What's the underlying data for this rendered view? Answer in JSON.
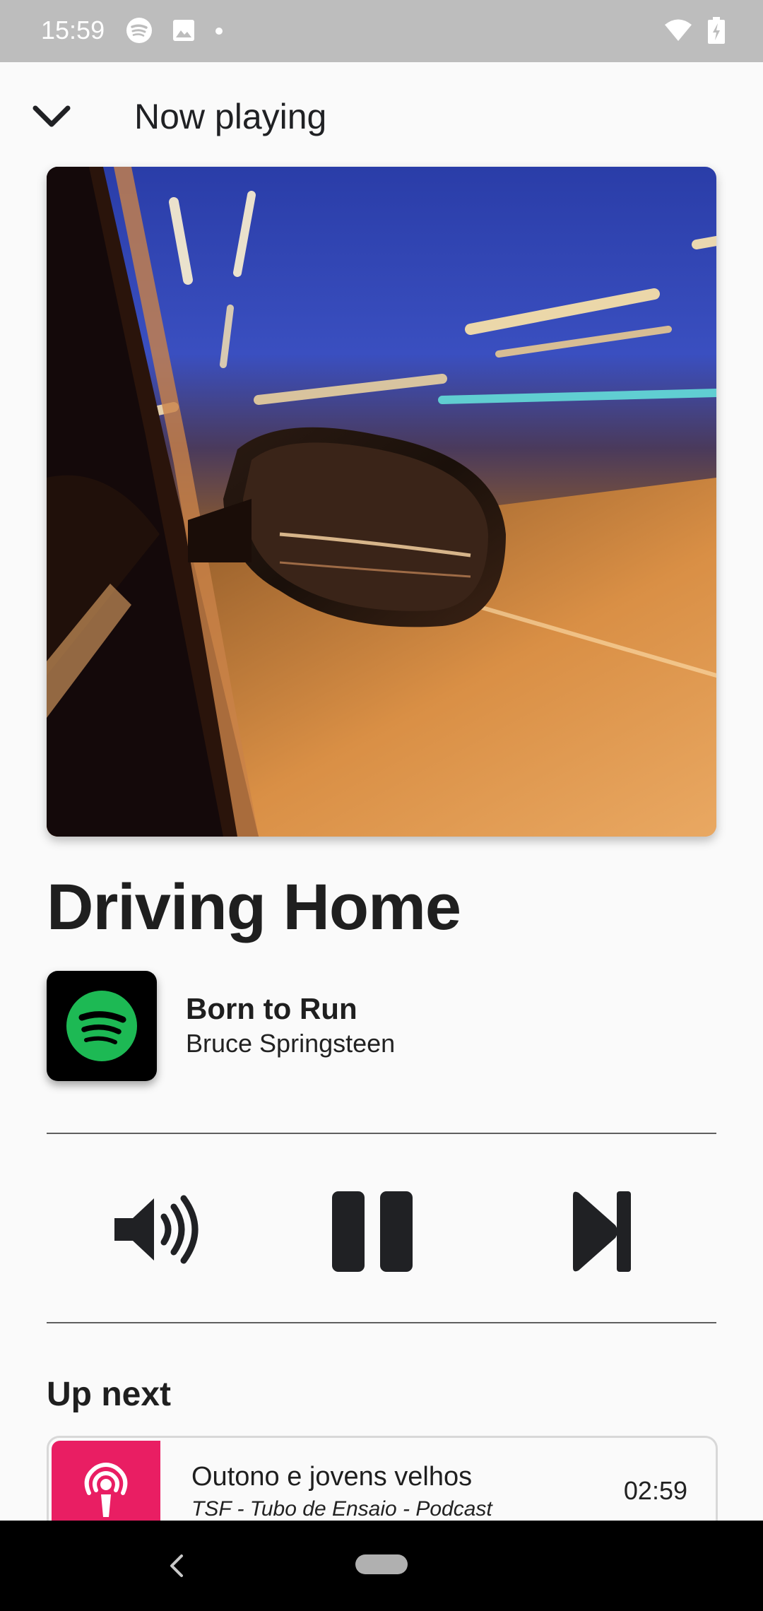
{
  "status_bar": {
    "time": "15:59",
    "icons": [
      "spotify-icon",
      "image-icon",
      "dot-icon",
      "wifi-icon",
      "battery-charging-icon"
    ]
  },
  "header": {
    "title": "Now playing",
    "collapse_icon": "chevron-down-icon"
  },
  "now_playing": {
    "title": "Driving Home",
    "album": "Born to Run",
    "artist": "Bruce Springsteen",
    "source_app_icon": "spotify-icon",
    "source_color": "#1db954"
  },
  "controls": {
    "volume_icon": "volume-icon",
    "play_pause_icon": "pause-icon",
    "next_icon": "skip-next-icon"
  },
  "up_next": {
    "heading": "Up next",
    "items": [
      {
        "title": "Outono e jovens velhos",
        "subtitle": "TSF - Tubo de Ensaio - Podcast",
        "duration": "02:59",
        "icon": "podcast-icon",
        "color": "#e91e63"
      }
    ]
  },
  "nav_bar": {
    "back_icon": "back-icon",
    "home_pill": "home-pill"
  }
}
